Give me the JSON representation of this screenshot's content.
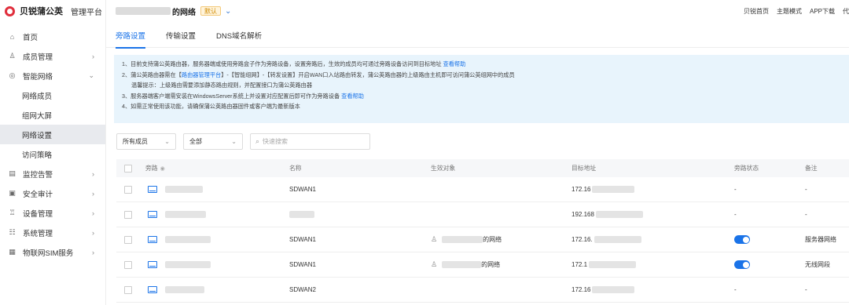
{
  "brand": {
    "name": "贝锐蒲公英",
    "subtitle": "管理平台",
    "accent": "#e02e3c"
  },
  "sidebar": {
    "items": [
      {
        "label": "首页",
        "icon": "home-icon"
      },
      {
        "label": "成员管理",
        "icon": "user-icon"
      },
      {
        "label": "智能网络",
        "icon": "network-icon",
        "expanded": true
      },
      {
        "label": "监控告警",
        "icon": "monitor-icon"
      },
      {
        "label": "安全审计",
        "icon": "audit-icon"
      },
      {
        "label": "设备管理",
        "icon": "device-icon"
      },
      {
        "label": "系统管理",
        "icon": "settings-icon"
      },
      {
        "label": "物联网SIM服务",
        "icon": "sim-icon"
      }
    ],
    "subitems": [
      {
        "label": "网络成员"
      },
      {
        "label": "组网大屏"
      },
      {
        "label": "网络设置",
        "active": true
      },
      {
        "label": "访问策略"
      }
    ]
  },
  "header": {
    "tenant_suffix": "的网络",
    "badge": "默认",
    "links": [
      "贝锐首页",
      "主题模式",
      "APP下载",
      "代"
    ]
  },
  "tabs": [
    "旁路设置",
    "传输设置",
    "DNS域名解析"
  ],
  "notice": {
    "l1_text": "1、目前支持蒲公英路由器，服务器端或使用旁路盒子作为旁路设备，设置旁路后，生效的成员均可通过旁路设备访问到目标地址",
    "l1_link": "查看帮助",
    "l2_a": "2、蒲公英路由器需在【",
    "l2_link": "路由器管理平台",
    "l2_b": "】-【智能组网】-【转发设置】开启WAN口入站路由转发，蒲公英路由器的上级路由主机即可访问蒲公英组网中的成员",
    "l2_tip": "温馨提示：上级路由需要添加静态路由规则，并配置接口为蒲公英路由器",
    "l3_text": "3、服务器端客户端需安装在WindowsServer系统上并设置对应配置后即可作为旁路设备",
    "l3_link": "查看帮助",
    "l4_text": "4、如需正常使用该功能，请确保蒲公英路由器固件或客户端为最新版本"
  },
  "filters": {
    "member_select": "所有成员",
    "status_select": "全部",
    "search_placeholder": "快速搜索"
  },
  "table": {
    "headers": [
      "旁路",
      "名称",
      "生效对象",
      "目标地址",
      "旁路状态",
      "备注"
    ],
    "rows": [
      {
        "name": "SDWAN1",
        "object": "",
        "ip": "172.16",
        "state": "-",
        "note": "-",
        "toggle": false
      },
      {
        "name": "",
        "object": "",
        "ip": "192.168",
        "state": "-",
        "note": "-",
        "toggle": false
      },
      {
        "name": "SDWAN1",
        "object": "的网络",
        "ip": "172.16.",
        "state": "",
        "note": "服务器网络",
        "toggle": true
      },
      {
        "name": "SDWAN1",
        "object": "的网络",
        "ip": "172.1",
        "state": "",
        "note": "无线网段",
        "toggle": true
      },
      {
        "name": "SDWAN2",
        "object": "",
        "ip": "172.16",
        "state": "-",
        "note": "-",
        "toggle": false
      }
    ]
  }
}
